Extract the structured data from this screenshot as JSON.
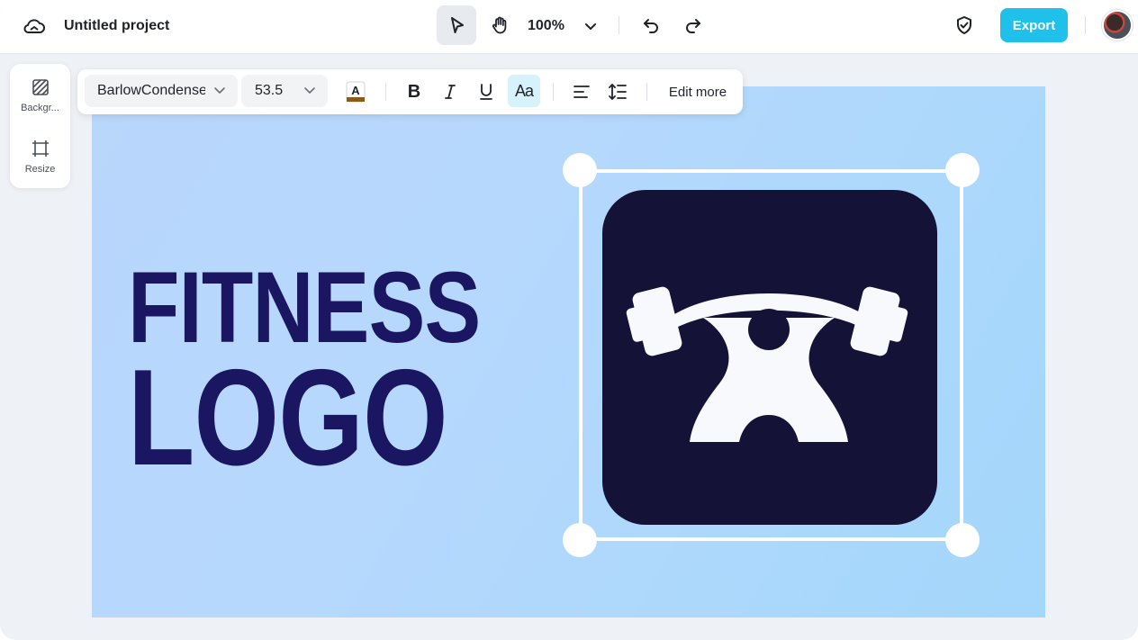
{
  "header": {
    "title": "Untitled project",
    "zoom": "100%",
    "export_label": "Export"
  },
  "text_toolbar": {
    "font_family": "BarlowCondensed",
    "font_size": "53.5",
    "edit_more_label": "Edit more",
    "bold_glyph": "B",
    "case_glyph": "Aa",
    "text_color_glyph": "A"
  },
  "sidebar": {
    "items": [
      {
        "label": "Backgr...",
        "icon": "background-icon"
      },
      {
        "label": "Resize",
        "icon": "resize-icon"
      }
    ]
  },
  "canvas": {
    "headline_line1": "FITNESS",
    "headline_line2": "LOGO",
    "logo_icon": "weightlifter-icon"
  },
  "colors": {
    "accent": "#1fc1ea",
    "headline": "#1a1662",
    "logo_tile": "#141237",
    "canvas_bg": "#b6d8fd",
    "text_color_swatch": "#8a5a1a"
  }
}
